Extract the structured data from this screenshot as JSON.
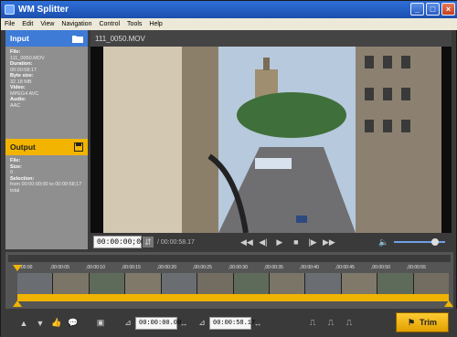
{
  "window": {
    "title": "WM Splitter",
    "buttons": [
      "_",
      "□",
      "×"
    ]
  },
  "menu": [
    "File",
    "Edit",
    "View",
    "Navigation",
    "Control",
    "Tools",
    "Help"
  ],
  "input_panel": {
    "heading": "Input",
    "fields": [
      {
        "label": "File:",
        "value": "111_0050.MOV"
      },
      {
        "label": "Duration:",
        "value": "00:00:58:17"
      },
      {
        "label": "Byte size:",
        "value": "32.18 MB"
      },
      {
        "label": "Video:",
        "value": "MPEG4 AVC"
      },
      {
        "label": "Audio:",
        "value": "AAC"
      }
    ]
  },
  "output_panel": {
    "heading": "Output",
    "fields": [
      {
        "label": "File:",
        "value": ""
      },
      {
        "label": "Size:",
        "value": "0"
      },
      {
        "label": "Selection:",
        "value": "from 00:00:00;00 to 00:00:58;17 total"
      }
    ]
  },
  "main": {
    "filename": "111_0050.MOV"
  },
  "player": {
    "current_time": "00:00:00;00",
    "total_time": "/ 00:00:58.17",
    "volume": 0.85
  },
  "timeline": {
    "ticks": [
      "00:00:00",
      ",00:00:05",
      ",00:00:10",
      ",00:00:15",
      ",00:00:20",
      ",00:00:25",
      ",00:00:30",
      ",00:00:35",
      ",00:00:40",
      ",00:00:45",
      ",00:00:50",
      ",00:00:55"
    ]
  },
  "bottom": {
    "start_time": "00:00:00.00",
    "end_time": "00:00:58.17",
    "trim_label": "Trim"
  },
  "colors": {
    "input": "#3e7bd6",
    "output": "#f2b400",
    "accent": "#f0b400"
  }
}
